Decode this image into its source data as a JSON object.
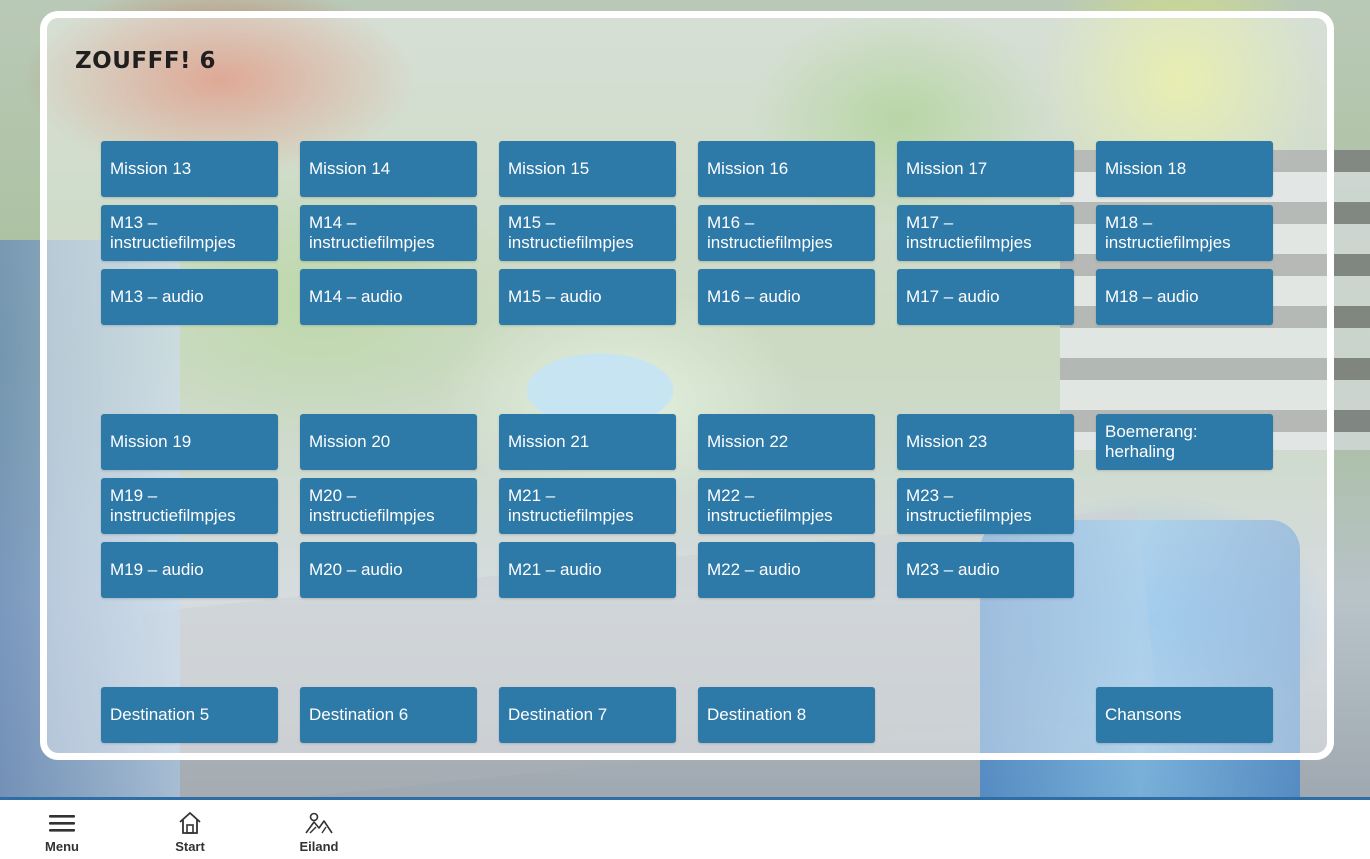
{
  "title": "ZOUFFF! 6",
  "tiles": [
    "Mission 13",
    "Mission 14",
    "Mission 15",
    "Mission 16",
    "Mission 17",
    "Mission 18",
    "M13 – instructiefilmpjes",
    "M14 – instructiefilmpjes",
    "M15 – instructiefilmpjes",
    "M16 – instructiefilmpjes",
    "M17 – instructiefilmpjes",
    "M18 – instructiefilmpjes",
    "M13 – audio",
    "M14 – audio",
    "M15 – audio",
    "M16 – audio",
    "M17 – audio",
    "M18 – audio",
    "Mission 19",
    "Mission 20",
    "Mission 21",
    "Mission 22",
    "Mission 23",
    "Boemerang: herhaling",
    "M19 – instructiefilmpjes",
    "M20 – instructiefilmpjes",
    "M21 – instructiefilmpjes",
    "M22 – instructiefilmpjes",
    "M23 – instructiefilmpjes",
    "M19 – audio",
    "M20 – audio",
    "M21 – audio",
    "M22 – audio",
    "M23 – audio",
    "Destination 5",
    "Destination 6",
    "Destination 7",
    "Destination 8",
    "Chansons"
  ],
  "nav": {
    "menu": "Menu",
    "start": "Start",
    "eiland": "Eiland"
  },
  "icons": {
    "menu": "hamburger-icon",
    "start": "home-icon",
    "eiland": "island-icon"
  },
  "colors": {
    "tile": "#2d79a7",
    "tile_text": "#ffffff",
    "panel_border": "#ffffff",
    "nav_text": "#333333"
  }
}
